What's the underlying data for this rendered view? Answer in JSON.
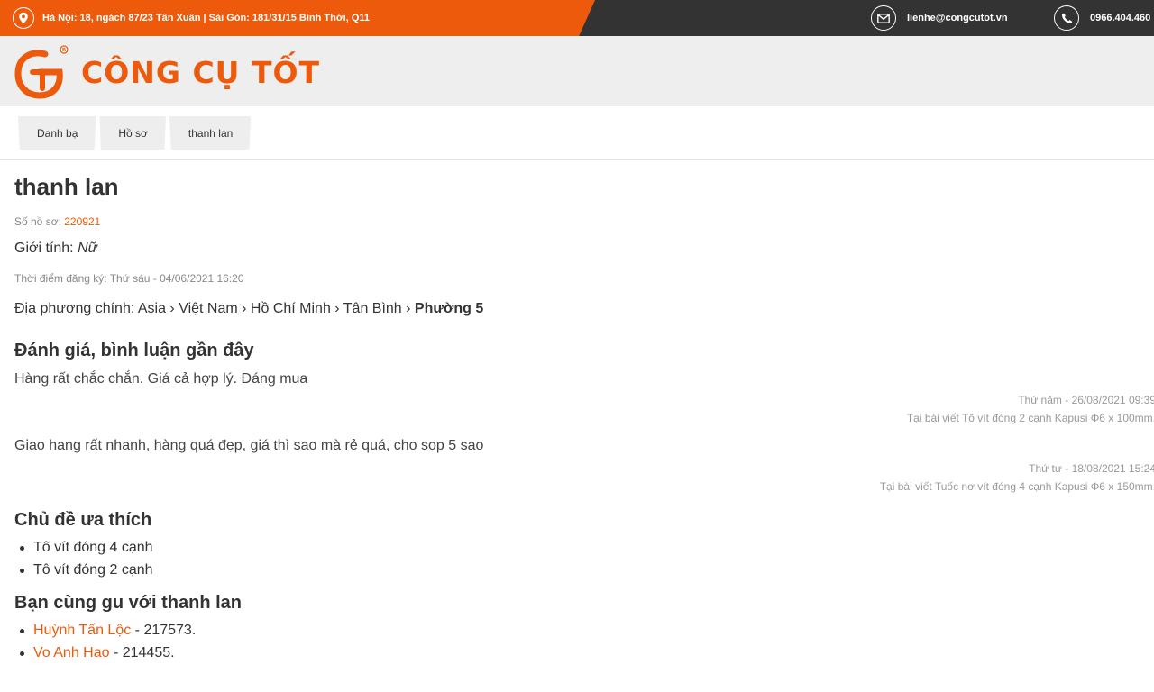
{
  "topbar": {
    "address": "Hà Nội: 18, ngách 87/23 Tân Xuân | Sài Gòn: 181/31/15 Bình Thới, Q11",
    "email": "lienhe@congcutot.vn",
    "phone": "0966.404.460",
    "icons": [
      "map-pin-icon",
      "envelope-icon",
      "phone-icon"
    ]
  },
  "logo": {
    "text": "CÔNG CỤ TỐT",
    "mark": "GT",
    "registered": "®"
  },
  "breadcrumb": [
    "Danh bạ",
    "Hồ sơ",
    "thanh lan"
  ],
  "profile": {
    "name": "thanh lan",
    "id_label": "Số hồ sơ:",
    "id_value": "220921",
    "gender_label": "Giới tính:",
    "gender_value": "Nữ",
    "registered": "Thời điểm đăng ký: Thứ sáu - 04/06/2021 16:20",
    "location_label": "Địa phương chính:",
    "location_path": "Asia › Việt Nam › Hồ Chí Minh › Tân Bình ›",
    "location_last": "Phường 5"
  },
  "reviews": {
    "title": "Đánh giá, bình luận gần đây",
    "items": [
      {
        "text": "Hàng rất chắc chắn. Giá cả hợp lý. Đáng mua",
        "date": "Thứ năm - 26/08/2021 09:39",
        "post": "Tại bài viết Tô vít đóng 2 cạnh Kapusi Φ6 x 100mm."
      },
      {
        "text": "Giao hang rất nhanh, hàng quá đẹp, giá thì sao mà rẻ quá, cho sop 5 sao",
        "date": "Thứ tư - 18/08/2021 15:24",
        "post": "Tại bài viết Tuốc nơ vít đóng 4 cạnh Kapusi Φ6 x 150mm."
      }
    ]
  },
  "favorites": {
    "title": "Chủ đề ưa thích",
    "items": [
      "Tô vít đóng 4 cạnh",
      "Tô vít đóng 2 cạnh"
    ]
  },
  "friends": {
    "title": "Bạn cùng gu với thanh lan",
    "items": [
      {
        "name": "Huỳnh Tấn Lộc",
        "id": " - 217573."
      },
      {
        "name": "Vo Anh Hao",
        "id": " - 214455."
      }
    ]
  },
  "colors": {
    "accent": "#ee5a0b",
    "dark_bar": "#333333",
    "header_bg": "#eeeeee"
  }
}
